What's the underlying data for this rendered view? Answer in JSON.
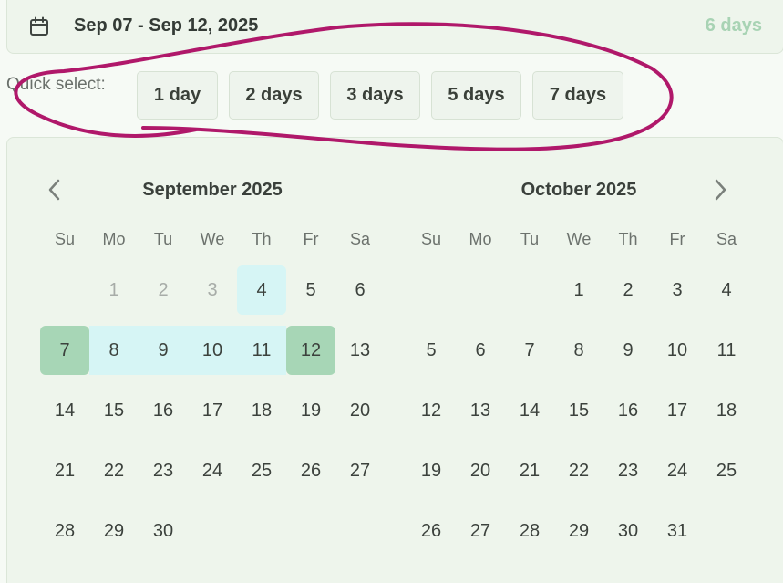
{
  "range": {
    "text": "Sep 07 - Sep 12, 2025",
    "days_count": "6 days",
    "icon": "calendar-icon"
  },
  "quick_select": {
    "label": "Quick select:",
    "options": [
      "1 day",
      "2 days",
      "3 days",
      "5 days",
      "7 days"
    ]
  },
  "calendar": {
    "prev_icon": "chevron-left-icon",
    "next_icon": "chevron-right-icon",
    "weekdays": [
      "Su",
      "Mo",
      "Tu",
      "We",
      "Th",
      "Fr",
      "Sa"
    ],
    "months": [
      {
        "title": "September 2025",
        "weeks": [
          [
            "",
            "1",
            "2",
            "3",
            "4",
            "5",
            "6"
          ],
          [
            "7",
            "8",
            "9",
            "10",
            "11",
            "12",
            "13"
          ],
          [
            "14",
            "15",
            "16",
            "17",
            "18",
            "19",
            "20"
          ],
          [
            "21",
            "22",
            "23",
            "24",
            "25",
            "26",
            "27"
          ],
          [
            "28",
            "29",
            "30",
            "",
            "",
            "",
            ""
          ]
        ],
        "disabled_days": [
          "1",
          "2",
          "3"
        ],
        "highlighted_days": [
          "4"
        ],
        "range_start": "7",
        "range_end": "12",
        "in_range_days": [
          "8",
          "9",
          "10",
          "11"
        ]
      },
      {
        "title": "October 2025",
        "weeks": [
          [
            "",
            "",
            "",
            "1",
            "2",
            "3",
            "4"
          ],
          [
            "5",
            "6",
            "7",
            "8",
            "9",
            "10",
            "11"
          ],
          [
            "12",
            "13",
            "14",
            "15",
            "16",
            "17",
            "18"
          ],
          [
            "19",
            "20",
            "21",
            "22",
            "23",
            "24",
            "25"
          ],
          [
            "26",
            "27",
            "28",
            "29",
            "30",
            "31",
            ""
          ]
        ],
        "disabled_days": [],
        "highlighted_days": [],
        "range_start": "",
        "range_end": "",
        "in_range_days": []
      }
    ]
  },
  "colors": {
    "accent_range_endpoint": "#a7d6b6",
    "accent_range_fill": "#d6f5f5",
    "days_count": "#a8d3b4",
    "annotation_stroke": "#b0186a"
  }
}
